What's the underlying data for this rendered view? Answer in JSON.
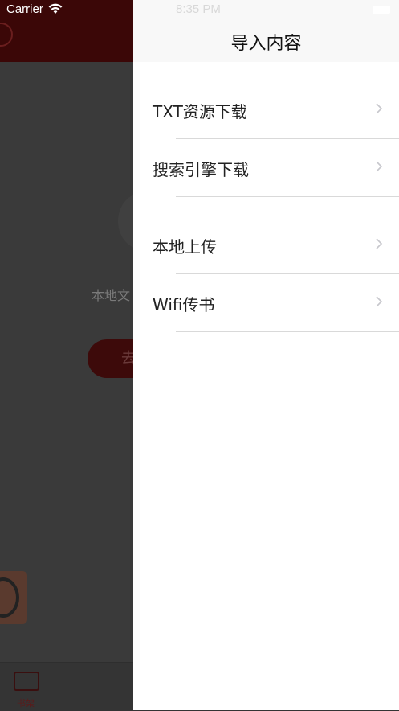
{
  "status_bar": {
    "carrier": "Carrier",
    "time": "8:35 PM"
  },
  "background": {
    "empty_text": "本地文",
    "button_label": "去",
    "tab_label": "书架"
  },
  "drawer": {
    "title": "导入内容",
    "items": [
      {
        "label": "TXT资源下载",
        "icon": "chevron-right-icon"
      },
      {
        "label": "搜索引擎下载",
        "icon": "chevron-right-icon"
      },
      {
        "label": "本地上传",
        "icon": "chevron-right-icon"
      },
      {
        "label": "Wifi传书",
        "icon": "chevron-right-icon"
      }
    ]
  },
  "colors": {
    "brand_dark_red": "#3b0707",
    "overlay": "#3a3a3a",
    "drawer_bg": "#ffffff",
    "header_bg": "#f8f8f8",
    "chevron": "#c7c7cc"
  }
}
